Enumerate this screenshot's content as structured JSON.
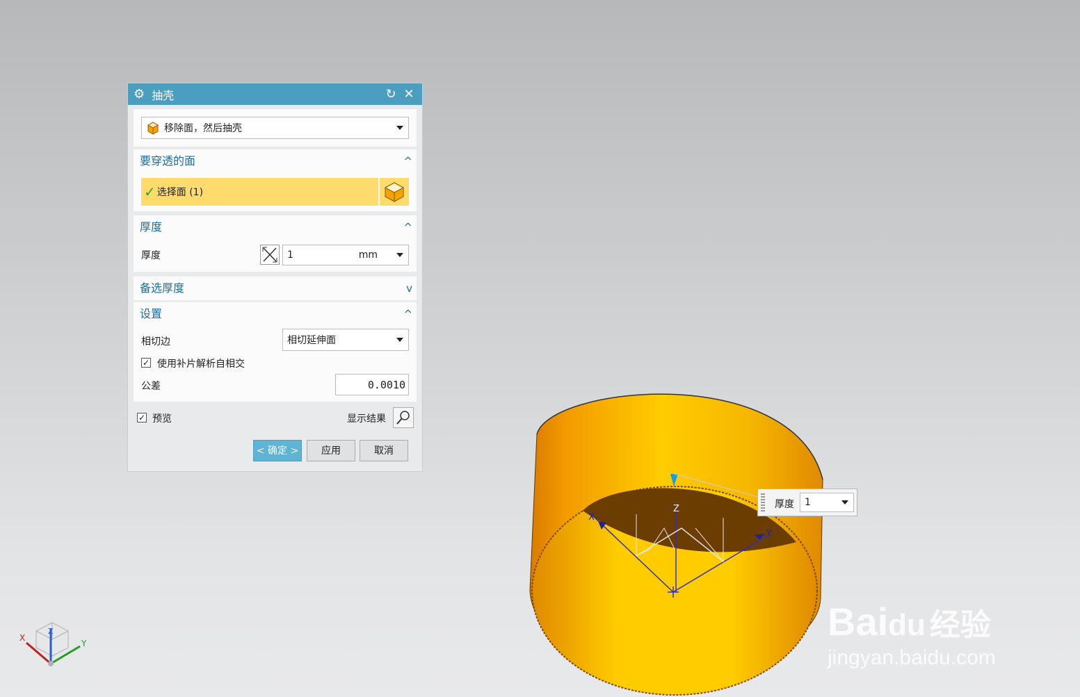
{
  "dialog": {
    "title": "抽壳",
    "type_select": "移除面，然后抽壳",
    "sections": {
      "faces_to_pierce": "要穿透的面",
      "thickness": "厚度",
      "alt_thickness": "备选厚度",
      "settings": "设置"
    },
    "select_face_label": "选择面 (1)",
    "thickness_label": "厚度",
    "thickness_value": "1",
    "thickness_unit": "mm",
    "tangent_edge_label": "相切边",
    "tangent_edge_value": "相切延伸面",
    "patch_checkbox_label": "使用补片解析自相交",
    "patch_checked": true,
    "tolerance_label": "公差",
    "tolerance_value": "0.0010",
    "preview_label": "预览",
    "preview_checked": true,
    "show_result_label": "显示结果",
    "ok_label": "< 确定 >",
    "apply_label": "应用",
    "cancel_label": "取消"
  },
  "floating_input": {
    "label": "厚度",
    "value": "1"
  },
  "triad": {
    "x": "X",
    "y": "Y",
    "z": "Z"
  },
  "csys": {
    "x": "X",
    "y": "Y",
    "z": "Z"
  },
  "watermark": {
    "brand": "Bai",
    "brand_paw": "du",
    "suffix": "经验",
    "url": "jingyan.baidu.com"
  },
  "colors": {
    "title_bar": "#4b9ebf",
    "section_header": "#1f6da0",
    "selection_highlight": "#fddb6d",
    "body_orange": "#f5a300",
    "body_inner": "#6b3d00"
  }
}
